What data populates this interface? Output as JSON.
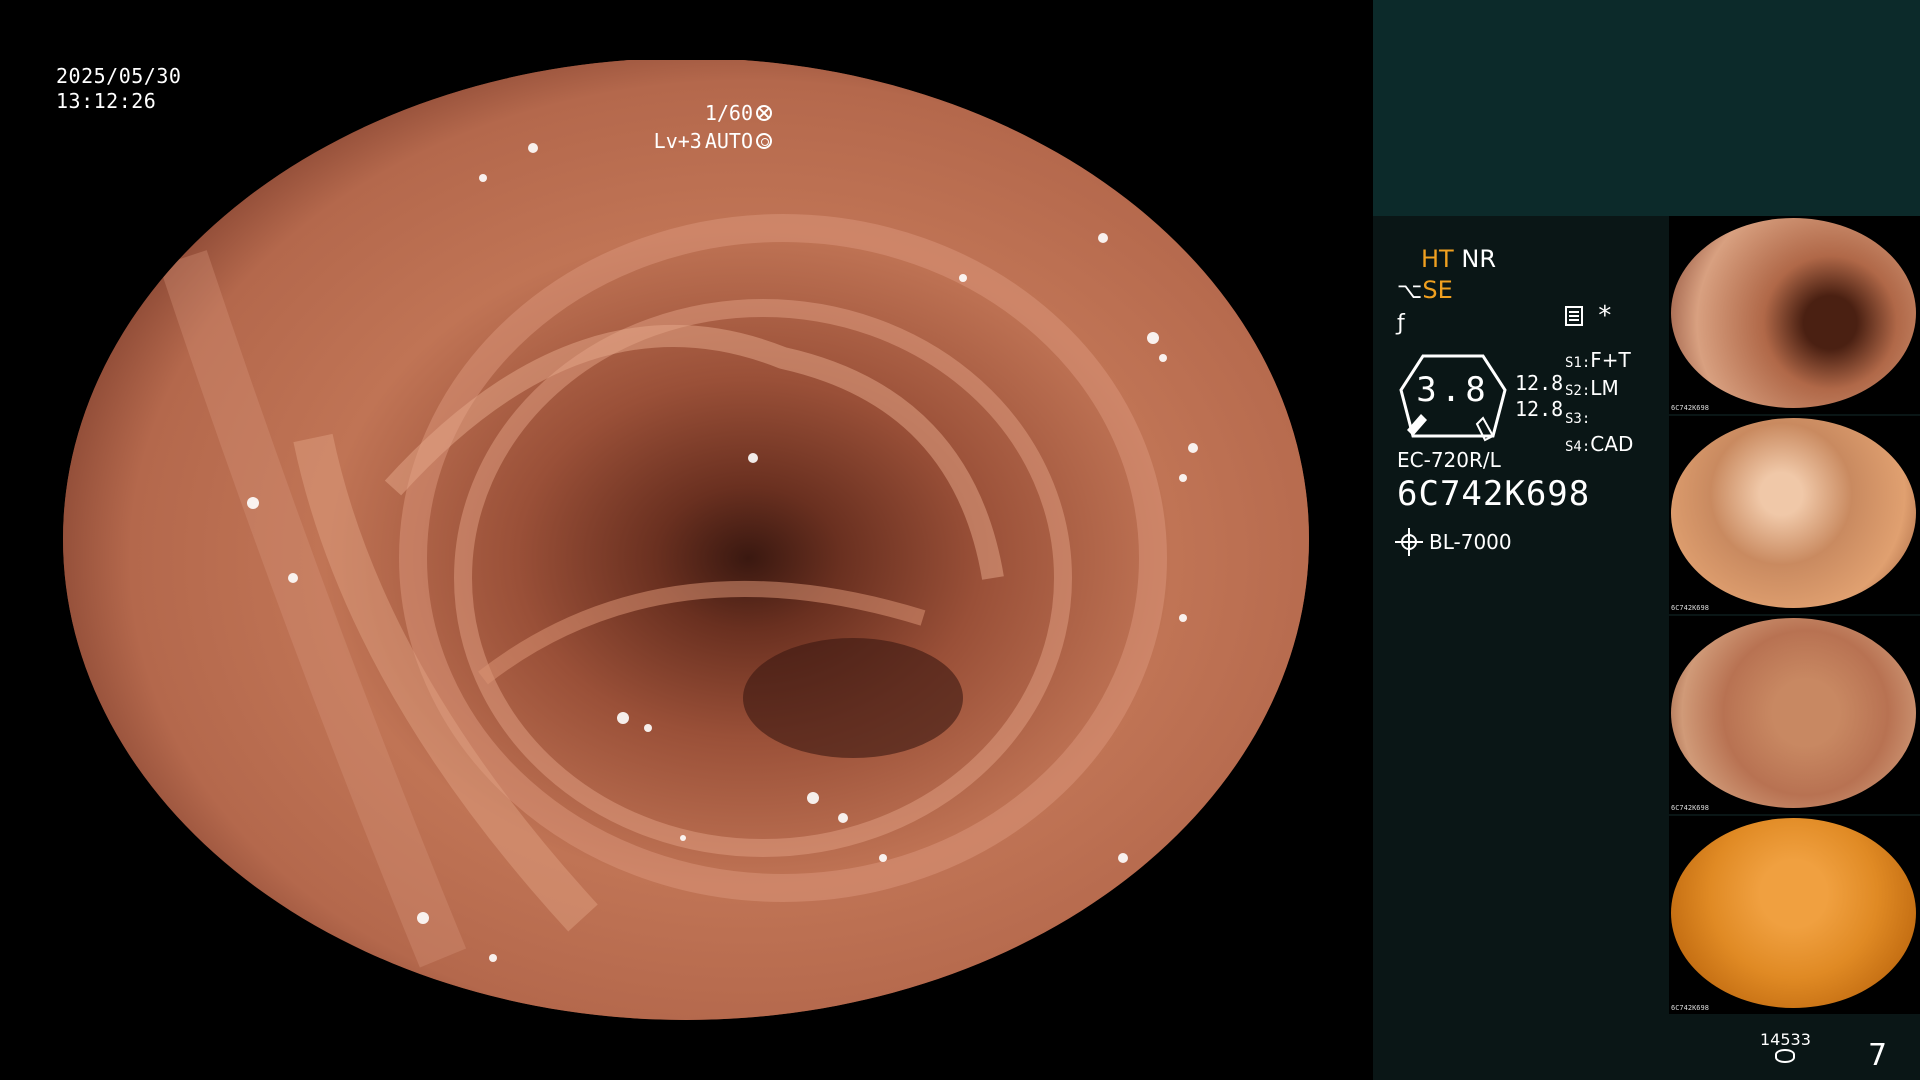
{
  "osd": {
    "date": "2025/05/30",
    "time": "13:12:26",
    "shutter": "1/60",
    "level": "Lv+3",
    "iris_mode": "AUTO"
  },
  "modes": {
    "ht": "HT",
    "nr": "NR",
    "se": "SE"
  },
  "gauge": {
    "value": "3.8",
    "num_top": "12.8",
    "num_bottom": "12.8"
  },
  "slots": [
    {
      "key": "S1",
      "value": "F+T"
    },
    {
      "key": "S2",
      "value": "LM"
    },
    {
      "key": "S3",
      "value": ""
    },
    {
      "key": "S4",
      "value": "CAD"
    }
  ],
  "scope": {
    "model": "EC-720R/L",
    "serial": "6C742K698",
    "light_source": "BL-7000"
  },
  "thumbnails": [
    {
      "label": "6C742K698",
      "tone": "#b06848"
    },
    {
      "label": "6C742K698",
      "tone": "#c98a60"
    },
    {
      "label": "6C742K698",
      "tone": "#b87252"
    },
    {
      "label": "6C742K698",
      "tone": "#e08a24"
    }
  ],
  "storage": {
    "free_count": "14533",
    "image_count": "7"
  },
  "icons": [
    "aperture-icon",
    "shutter-icon",
    "scope-icon",
    "water-icon",
    "report-icon",
    "asterisk-icon",
    "sun-icon",
    "disk-icon"
  ],
  "colors": {
    "accent_orange": "#f0a020",
    "panel_bg": "#0a1616",
    "panel_top_bg": "#0c2a2a"
  }
}
